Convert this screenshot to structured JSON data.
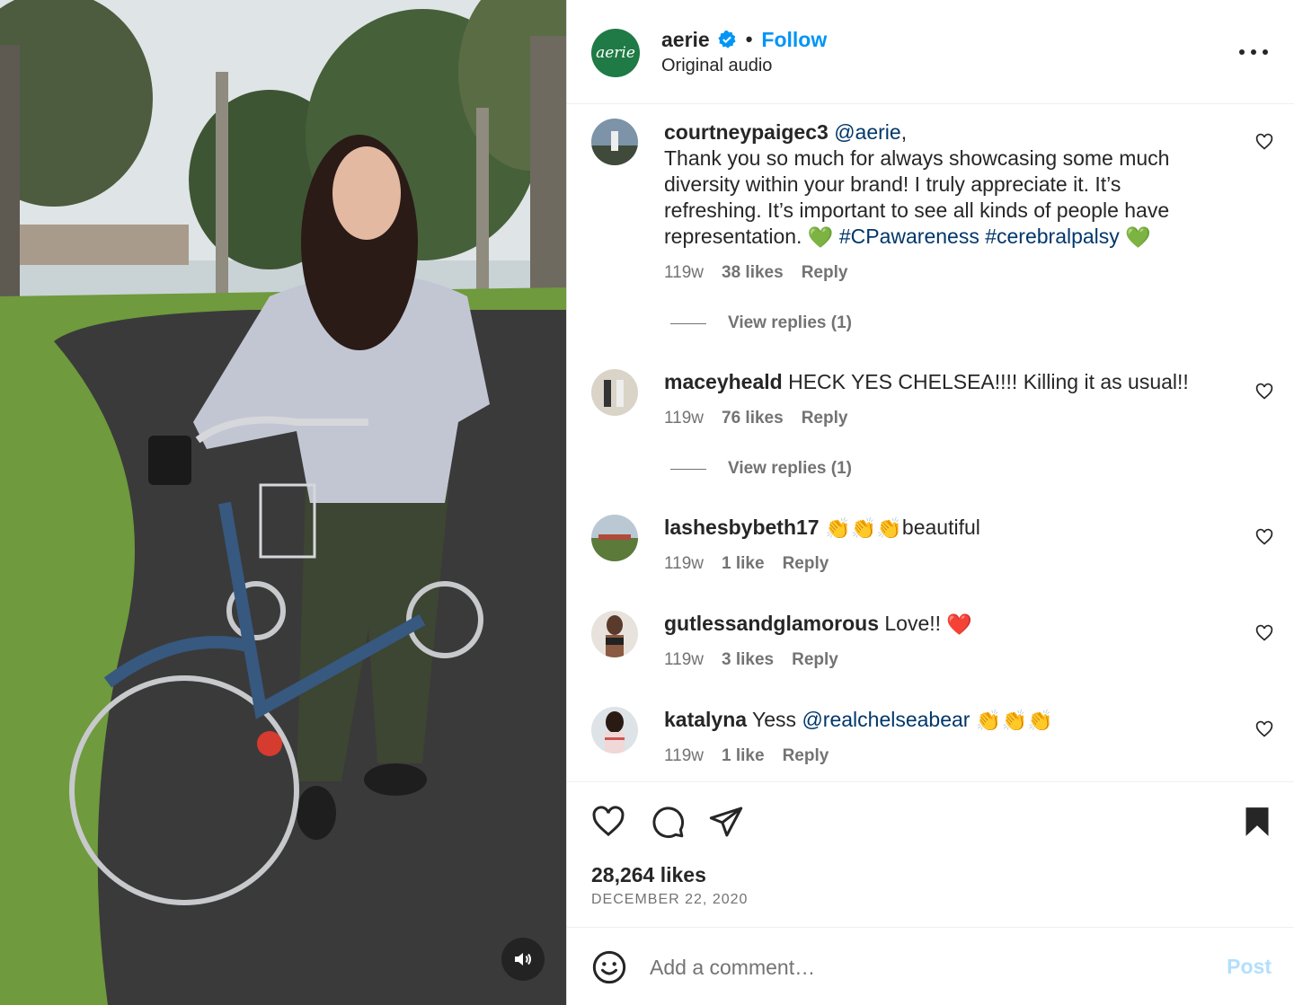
{
  "post": {
    "author": "aerie",
    "avatar_text": "aerie",
    "verified": true,
    "separator": "•",
    "follow_label": "Follow",
    "audio_label": "Original audio",
    "likes": "28,264 likes",
    "date": "DECEMBER 22, 2020"
  },
  "comments": [
    {
      "user": "courtneypaigec3",
      "mention": "@aerie",
      "text_a": ",",
      "text_b": "Thank you so much for always showcasing some much diversity within your brand! I truly appreciate it. It’s refreshing. It’s important to see all kinds of people have representation. ",
      "tags": "#CPawareness #cerebralpalsy",
      "emoji_before_tags": "💚",
      "emoji_after_tags": "💚",
      "time": "119w",
      "likes": "38 likes",
      "reply": "Reply",
      "view_replies": "View replies (1)"
    },
    {
      "user": "maceyheald",
      "text": " HECK YES CHELSEA!!!! Killing it as usual!!",
      "time": "119w",
      "likes": "76 likes",
      "reply": "Reply",
      "view_replies": "View replies (1)"
    },
    {
      "user": "lashesbybeth17",
      "emoji": "👏👏👏",
      "text": "beautiful",
      "time": "119w",
      "likes": "1 like",
      "reply": "Reply"
    },
    {
      "user": "gutlessandglamorous",
      "text": " Love!! ",
      "emoji": "❤️",
      "time": "119w",
      "likes": "3 likes",
      "reply": "Reply"
    },
    {
      "user": "katalyna",
      "text": " Yess ",
      "mention": "@realchelseabear",
      "emoji": "👏👏👏",
      "time": "119w",
      "likes": "1 like",
      "reply": "Reply"
    }
  ],
  "composer": {
    "placeholder": "Add a comment…",
    "post_label": "Post"
  },
  "colors": {
    "link": "#0095f6",
    "mention": "#00376b",
    "secondary": "#737373",
    "brand_avatar": "#1f7a45"
  },
  "icons": [
    "verified-badge-icon",
    "more-options-icon",
    "heart-icon",
    "comment-icon",
    "share-icon",
    "bookmark-icon",
    "emoji-icon",
    "speaker-icon"
  ]
}
